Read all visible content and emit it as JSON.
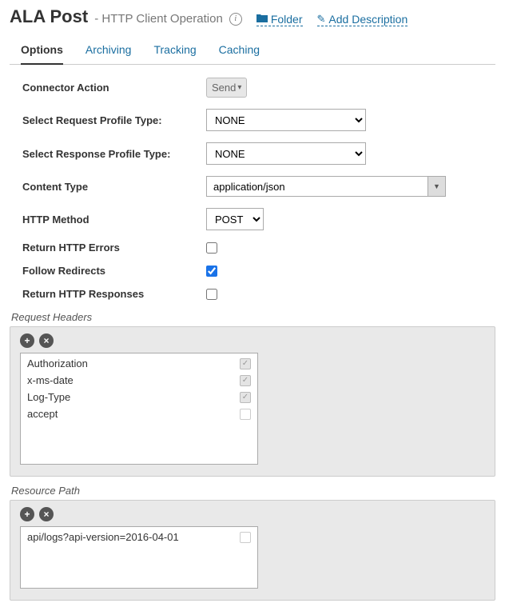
{
  "header": {
    "title": "ALA Post",
    "subtitle": "- HTTP Client Operation",
    "folder_label": "Folder",
    "add_desc_label": "Add Description"
  },
  "tabs": {
    "items": [
      {
        "label": "Options",
        "active": true
      },
      {
        "label": "Archiving",
        "active": false
      },
      {
        "label": "Tracking",
        "active": false
      },
      {
        "label": "Caching",
        "active": false
      }
    ]
  },
  "form": {
    "connector_action_label": "Connector Action",
    "connector_action_value": "Send",
    "request_profile_label": "Select Request Profile Type:",
    "request_profile_value": "NONE",
    "response_profile_label": "Select Response Profile Type:",
    "response_profile_value": "NONE",
    "content_type_label": "Content Type",
    "content_type_value": "application/json",
    "http_method_label": "HTTP Method",
    "http_method_value": "POST",
    "return_errors_label": "Return HTTP Errors",
    "return_errors_checked": false,
    "follow_redirects_label": "Follow Redirects",
    "follow_redirects_checked": true,
    "return_responses_label": "Return HTTP Responses",
    "return_responses_checked": false
  },
  "request_headers": {
    "section_title": "Request Headers",
    "items": [
      {
        "name": "Authorization",
        "checked": true
      },
      {
        "name": "x-ms-date",
        "checked": true
      },
      {
        "name": "Log-Type",
        "checked": true
      },
      {
        "name": "accept",
        "checked": false
      }
    ]
  },
  "resource_path": {
    "section_title": "Resource Path",
    "items": [
      {
        "name": "api/logs?api-version=2016-04-01",
        "checked": false
      }
    ]
  }
}
